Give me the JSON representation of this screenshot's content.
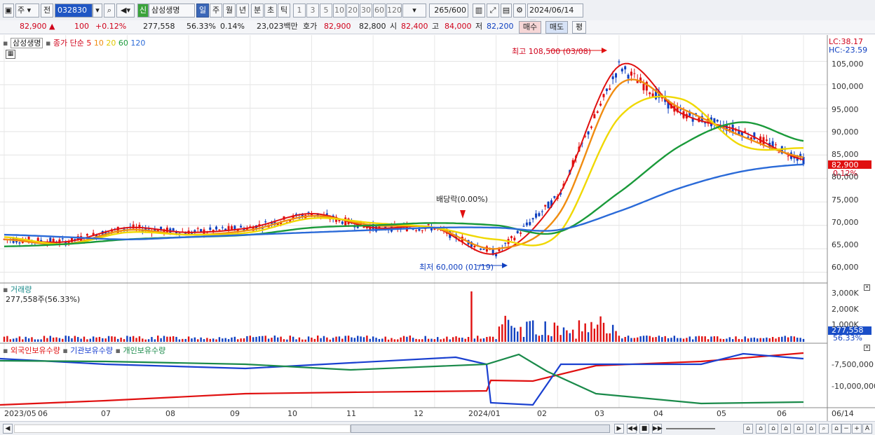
{
  "toolbar": {
    "period_select": "주",
    "prev_label": "전",
    "stock_code": "032830",
    "new_badge": "신",
    "stock_name": "삼성생명",
    "periods": [
      "일",
      "주",
      "월",
      "년",
      "분",
      "초",
      "틱"
    ],
    "intervals": [
      "1",
      "3",
      "5",
      "10",
      "20",
      "30",
      "60",
      "120"
    ],
    "count": "265",
    "count_total": "/600",
    "date": "2024/06/14"
  },
  "info": {
    "price": "82,900",
    "change": "100",
    "change_pct": "+0.12%",
    "volume": "277,558",
    "turnover_pct": "56.33%",
    "ratio": "0.14%",
    "amount": "23,023백만",
    "bid_label": "호가",
    "bid": "82,900",
    "ask": "82,800",
    "open_label": "시",
    "open": "82,400",
    "high_label": "고",
    "high": "84,000",
    "low_label": "저",
    "low": "82,200",
    "buy_btn": "매수",
    "sell_btn": "매도",
    "eval_btn": "평"
  },
  "price_pane": {
    "stock_label": "삼성생명",
    "ma_label": "종가 단순",
    "ma_periods": [
      {
        "label": "5",
        "color": "#e01010"
      },
      {
        "label": "10",
        "color": "#f08c10"
      },
      {
        "label": "20",
        "color": "#f0d800"
      },
      {
        "label": "60",
        "color": "#1a9a3a"
      },
      {
        "label": "120",
        "color": "#2a6ad8"
      }
    ],
    "lc": "LC:38.17",
    "hc": "HC:-23.59",
    "annotation_high": "최고 108,500 (03/08)",
    "annotation_low": "최저 60,000 (01/19)",
    "annotation_dividend": "배당락(0.00%)",
    "current_price_tag": "82,900",
    "current_pct_tag": "0.12%",
    "y_ticks": [
      "105,000",
      "100,000",
      "95,000",
      "90,000",
      "85,000",
      "80,000",
      "75,000",
      "70,000",
      "65,000",
      "60,000"
    ]
  },
  "volume_pane": {
    "title": "거래량",
    "value": "277,558주(56.33%)",
    "y_ticks": [
      "3,000K",
      "2,000K",
      "1,000K"
    ],
    "tag_value": "277,558",
    "tag_pct": "56.33%"
  },
  "holding_pane": {
    "foreign": "외국인보유수량",
    "institution": "기관보유수량",
    "individual": "개인보유수량",
    "y_ticks": [
      "-7,500,000",
      "-10,000,000"
    ]
  },
  "x_axis": [
    "2023/05",
    "06",
    "07",
    "08",
    "09",
    "10",
    "11",
    "12",
    "2024/01",
    "02",
    "03",
    "04",
    "05",
    "06"
  ],
  "x_axis_right": "06/14",
  "chart_data": {
    "type": "line",
    "title": "삼성생명",
    "x": [
      "2023/05",
      "06",
      "07",
      "08",
      "09",
      "10",
      "11",
      "12",
      "2024/01",
      "02",
      "03",
      "04",
      "05",
      "06"
    ],
    "series": [
      {
        "name": "5",
        "values": [
          67000,
          66500,
          69500,
          68500,
          69500,
          72500,
          69500,
          69500,
          64000,
          76000,
          104000,
          94000,
          90000,
          84000
        ]
      },
      {
        "name": "10",
        "values": [
          67000,
          66000,
          69000,
          68000,
          69000,
          72000,
          70000,
          69500,
          65000,
          72000,
          100000,
          95000,
          89000,
          84500
        ]
      },
      {
        "name": "20",
        "values": [
          67500,
          66000,
          68500,
          68000,
          68500,
          71500,
          70500,
          69500,
          67000,
          68000,
          93000,
          97000,
          87000,
          86500
        ]
      },
      {
        "name": "60",
        "values": [
          65500,
          66000,
          67000,
          67500,
          68000,
          69500,
          70000,
          70500,
          70000,
          68500,
          77000,
          87000,
          92000,
          88000
        ]
      },
      {
        "name": "120",
        "values": [
          68000,
          67500,
          67000,
          67500,
          68000,
          68500,
          69000,
          69500,
          69500,
          69000,
          73000,
          78000,
          81500,
          83000
        ]
      }
    ],
    "high": {
      "value": 108500,
      "date": "03/08"
    },
    "low": {
      "value": 60000,
      "date": "01/19"
    },
    "ylim": [
      58000,
      110000
    ]
  }
}
